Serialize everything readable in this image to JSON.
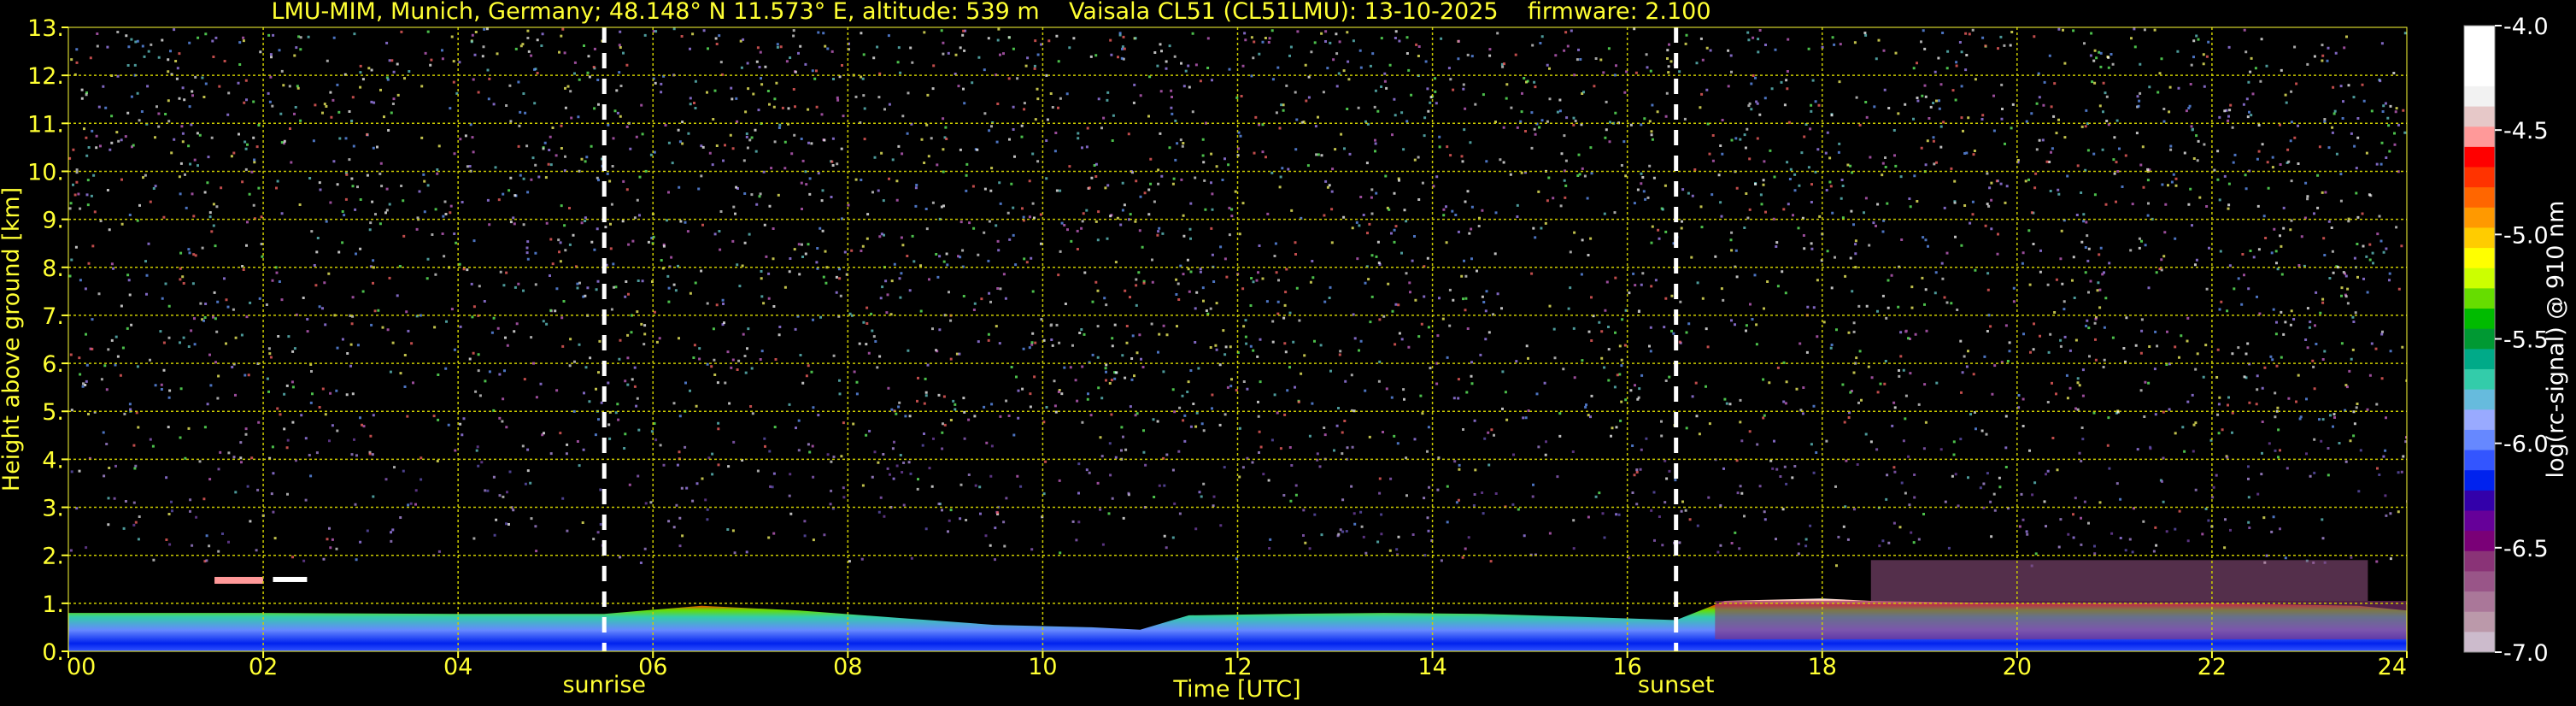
{
  "header": {
    "title": "LMU-MIM, Munich, Germany; 48.148° N 11.573° E, altitude: 539 m    Vaisala CL51 (CL51LMU): 13-10-2025    firmware: 2.100"
  },
  "colors": {
    "background": "#000000",
    "axis_text": "#ffff33",
    "grid": "#cccc00",
    "marker_lines": "#ffffff"
  },
  "chart_data": {
    "type": "heatmap",
    "xlabel": "Time [UTC]",
    "ylabel": "Height above ground [km]",
    "xlim": [
      0,
      24
    ],
    "ylim": [
      0,
      13
    ],
    "x_ticks": [
      "00",
      "02",
      "04",
      "06",
      "08",
      "10",
      "12",
      "14",
      "16",
      "18",
      "20",
      "22",
      "24"
    ],
    "y_ticks": [
      "0.",
      "1.",
      "2.",
      "3.",
      "4.",
      "5.",
      "6.",
      "7.",
      "8.",
      "9.",
      "10.",
      "11.",
      "12.",
      "13."
    ],
    "grid": true,
    "markers": [
      {
        "label": "sunrise",
        "x": 5.5
      },
      {
        "label": "sunset",
        "x": 16.5
      }
    ],
    "boundary_layer_top_km": [
      [
        0,
        0.8
      ],
      [
        2,
        0.8
      ],
      [
        4,
        0.78
      ],
      [
        5.5,
        0.78
      ],
      [
        6.5,
        0.95
      ],
      [
        7.5,
        0.85
      ],
      [
        8.5,
        0.7
      ],
      [
        9.5,
        0.55
      ],
      [
        10.5,
        0.5
      ],
      [
        11,
        0.45
      ],
      [
        11.5,
        0.75
      ],
      [
        12.5,
        0.78
      ],
      [
        13.5,
        0.8
      ],
      [
        14.5,
        0.78
      ],
      [
        15.5,
        0.72
      ],
      [
        16.5,
        0.65
      ],
      [
        17,
        1.05
      ],
      [
        18,
        1.1
      ],
      [
        18.5,
        1.05
      ],
      [
        20,
        1.0
      ],
      [
        22,
        1.0
      ],
      [
        23.5,
        0.95
      ],
      [
        24,
        0.85
      ]
    ],
    "colorbar": {
      "label": "log(rc-signal) @ 910 nm",
      "range": [
        -7.0,
        -4.0
      ],
      "ticks": [
        "-4.0",
        "-4.5",
        "-5.0",
        "-5.5",
        "-6.0",
        "-6.5",
        "-7.0"
      ],
      "colors": [
        "#ffffff",
        "#ffffff",
        "#ffffff",
        "#f2f2f2",
        "#e6c8c8",
        "#ff9999",
        "#ff0000",
        "#ff3300",
        "#ff6600",
        "#ff9900",
        "#ffcc00",
        "#ffff00",
        "#ccff00",
        "#66dd00",
        "#00bb00",
        "#009933",
        "#00aa88",
        "#33ccaa",
        "#66bbdd",
        "#99aaff",
        "#6688ff",
        "#3355ff",
        "#0022ee",
        "#3300aa",
        "#660099",
        "#7a0077",
        "#8a3377",
        "#995588",
        "#aa7799",
        "#bb99aa",
        "#ccbbcc"
      ]
    }
  }
}
